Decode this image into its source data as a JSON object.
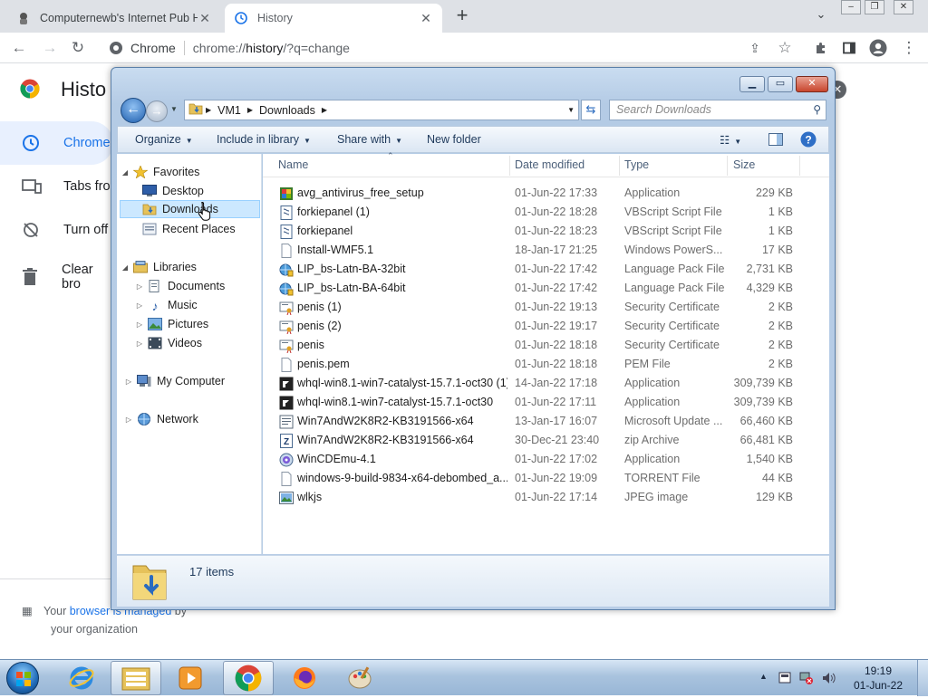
{
  "browser": {
    "tabs": [
      {
        "title": "Computernewb's Internet Pub H",
        "active": false
      },
      {
        "title": "History",
        "active": true
      }
    ],
    "new_tab_label": "+",
    "omnibox": {
      "site_label": "Chrome",
      "url_prefix": "chrome://",
      "url_host": "history",
      "url_rest": "/?q=change"
    }
  },
  "history_page": {
    "title": "Histo",
    "nav": [
      {
        "label": "Chrome",
        "selected": true
      },
      {
        "label": "Tabs fro",
        "selected": false
      },
      {
        "label": "Turn off",
        "selected": false
      },
      {
        "label": "Clear bro",
        "selected": false
      }
    ],
    "managed": {
      "prefix": "Your ",
      "link": "browser is managed",
      "suffix": " by",
      "line2": "your organization"
    }
  },
  "explorer": {
    "breadcrumb": [
      "VM1",
      "Downloads"
    ],
    "search_placeholder": "Search Downloads",
    "commands": {
      "organize": "Organize",
      "include": "Include in library",
      "share": "Share with",
      "new_folder": "New folder"
    },
    "tree": {
      "favorites": "Favorites",
      "desktop": "Desktop",
      "downloads": "Downloads",
      "recent": "Recent Places",
      "libraries": "Libraries",
      "documents": "Documents",
      "music": "Music",
      "pictures": "Pictures",
      "videos": "Videos",
      "computer": "My Computer",
      "network": "Network"
    },
    "columns": {
      "name": "Name",
      "date": "Date modified",
      "type": "Type",
      "size": "Size"
    },
    "files": [
      {
        "name": "avg_antivirus_free_setup",
        "date": "01-Jun-22 17:33",
        "type": "Application",
        "size": "229 KB",
        "icon": "avg-icon"
      },
      {
        "name": "forkiepanel (1)",
        "date": "01-Jun-22 18:28",
        "type": "VBScript Script File",
        "size": "1 KB",
        "icon": "script-icon"
      },
      {
        "name": "forkiepanel",
        "date": "01-Jun-22 18:23",
        "type": "VBScript Script File",
        "size": "1 KB",
        "icon": "script-icon"
      },
      {
        "name": "Install-WMF5.1",
        "date": "18-Jan-17 21:25",
        "type": "Windows PowerS...",
        "size": "17 KB",
        "icon": "file-icon"
      },
      {
        "name": "LIP_bs-Latn-BA-32bit",
        "date": "01-Jun-22 17:42",
        "type": "Language Pack File",
        "size": "2,731 KB",
        "icon": "langpack-icon"
      },
      {
        "name": "LIP_bs-Latn-BA-64bit",
        "date": "01-Jun-22 17:42",
        "type": "Language Pack File",
        "size": "4,329 KB",
        "icon": "langpack-icon"
      },
      {
        "name": "penis (1)",
        "date": "01-Jun-22 19:13",
        "type": "Security Certificate",
        "size": "2 KB",
        "icon": "certificate-icon"
      },
      {
        "name": "penis (2)",
        "date": "01-Jun-22 19:17",
        "type": "Security Certificate",
        "size": "2 KB",
        "icon": "certificate-icon"
      },
      {
        "name": "penis",
        "date": "01-Jun-22 18:18",
        "type": "Security Certificate",
        "size": "2 KB",
        "icon": "certificate-icon"
      },
      {
        "name": "penis.pem",
        "date": "01-Jun-22 18:18",
        "type": "PEM File",
        "size": "2 KB",
        "icon": "file-icon"
      },
      {
        "name": "whql-win8.1-win7-catalyst-15.7.1-oct30 (1)",
        "date": "14-Jan-22 17:18",
        "type": "Application",
        "size": "309,739 KB",
        "icon": "amd-icon"
      },
      {
        "name": "whql-win8.1-win7-catalyst-15.7.1-oct30",
        "date": "01-Jun-22 17:11",
        "type": "Application",
        "size": "309,739 KB",
        "icon": "amd-icon"
      },
      {
        "name": "Win7AndW2K8R2-KB3191566-x64",
        "date": "13-Jan-17 16:07",
        "type": "Microsoft Update ...",
        "size": "66,460 KB",
        "icon": "update-icon"
      },
      {
        "name": "Win7AndW2K8R2-KB3191566-x64",
        "date": "30-Dec-21 23:40",
        "type": "zip Archive",
        "size": "66,481 KB",
        "icon": "zip-icon"
      },
      {
        "name": "WinCDEmu-4.1",
        "date": "01-Jun-22 17:02",
        "type": "Application",
        "size": "1,540 KB",
        "icon": "disc-icon"
      },
      {
        "name": "windows-9-build-9834-x64-debombed_a...",
        "date": "01-Jun-22 19:09",
        "type": "TORRENT File",
        "size": "44 KB",
        "icon": "file-icon"
      },
      {
        "name": "wlkjs",
        "date": "01-Jun-22 17:14",
        "type": "JPEG image",
        "size": "129 KB",
        "icon": "image-icon"
      }
    ],
    "item_count": "17 items"
  },
  "taskbar": {
    "clock_time": "19:19",
    "clock_date": "01-Jun-22"
  },
  "colors": {
    "chrome_accent": "#1a73e8",
    "explorer_frame": "#b8cde6",
    "selection": "#cce8ff"
  }
}
